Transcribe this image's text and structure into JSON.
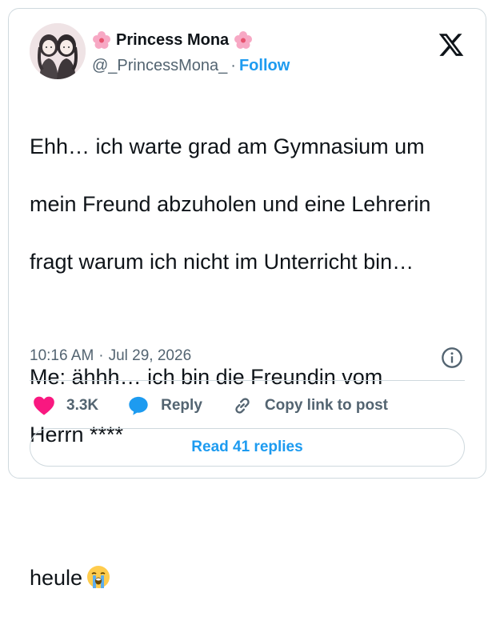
{
  "author": {
    "display_name": "Princess Mona",
    "handle": "@_PrincessMona_",
    "separator": "·",
    "follow_label": "Follow"
  },
  "tweet": {
    "lines_para1": [
      "Ehh… ich warte grad am Gymnasium um",
      "mein Freund abzuholen und eine Lehrerin",
      "fragt warum ich nicht im Unterricht bin…"
    ],
    "lines_para2": [
      "Me: ähhh… ich bin die Freundin vom",
      "Herrn ****"
    ],
    "para3": "heule",
    "time": "10:16 AM",
    "meta_separator": "·",
    "date": "Jul 29, 2026"
  },
  "actions": {
    "likes_count": "3.3K",
    "reply_label": "Reply",
    "copy_link_label": "Copy link to post"
  },
  "read_replies_label": "Read 41 replies",
  "colors": {
    "accent": "#1d9bf0",
    "like": "#f91880",
    "secondary_text": "#536471",
    "border": "#cfd9de"
  },
  "icons": [
    "flower-emoji-icon",
    "x-logo-icon",
    "crying-face-emoji-icon",
    "info-icon",
    "heart-icon",
    "reply-bubble-icon",
    "link-icon"
  ]
}
